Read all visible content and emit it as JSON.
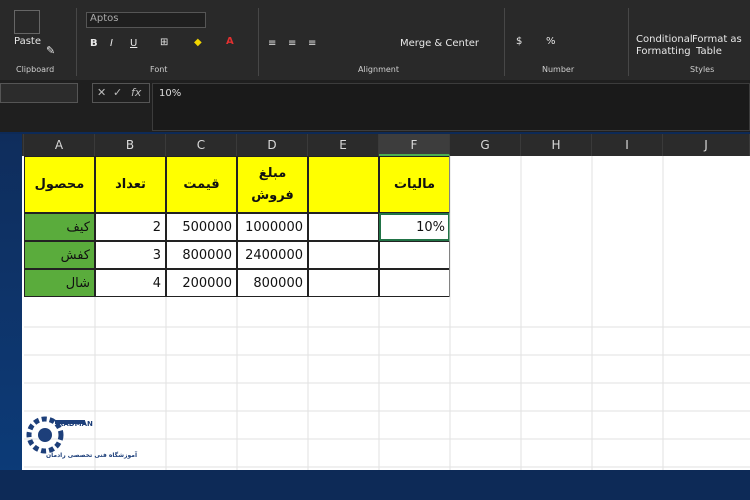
{
  "ribbon": {
    "font_name": "Aptos",
    "groups": {
      "clipboard": "Clipboard",
      "font": "Font",
      "alignment": "Alignment",
      "number": "Number",
      "styles": "Styles"
    },
    "paste_label": "Paste",
    "merge_label": "Merge & Center",
    "conditional_label_1": "Conditional",
    "conditional_label_2": "Formatting",
    "format_table_1": "Format as",
    "format_table_2": "Table",
    "bold": "B",
    "italic": "I",
    "underline": "U",
    "percent": "%",
    "fx": "fx"
  },
  "formula_bar": {
    "value": "10%"
  },
  "columns": [
    "A",
    "B",
    "C",
    "D",
    "E",
    "F",
    "G",
    "H",
    "I",
    "J"
  ],
  "headers": {
    "a": "محصول",
    "b": "تعداد",
    "c": "قیمت",
    "d": "مبلغ فروش",
    "e": "",
    "f": "مالیات"
  },
  "rows": [
    {
      "a": "کیف",
      "b": "2",
      "c": "500000",
      "d": "1000000",
      "f": "10%"
    },
    {
      "a": "کفش",
      "b": "3",
      "c": "800000",
      "d": "2400000",
      "f": ""
    },
    {
      "a": "شال",
      "b": "4",
      "c": "200000",
      "d": "800000",
      "f": ""
    }
  ],
  "logo": {
    "brand": "RADMAN",
    "tagline": "آموزشگاه فنی تخصصی رادمان"
  },
  "colors": {
    "header_fill": "#ffff00",
    "product_fill": "#5aac3c",
    "selection": "#217346"
  }
}
